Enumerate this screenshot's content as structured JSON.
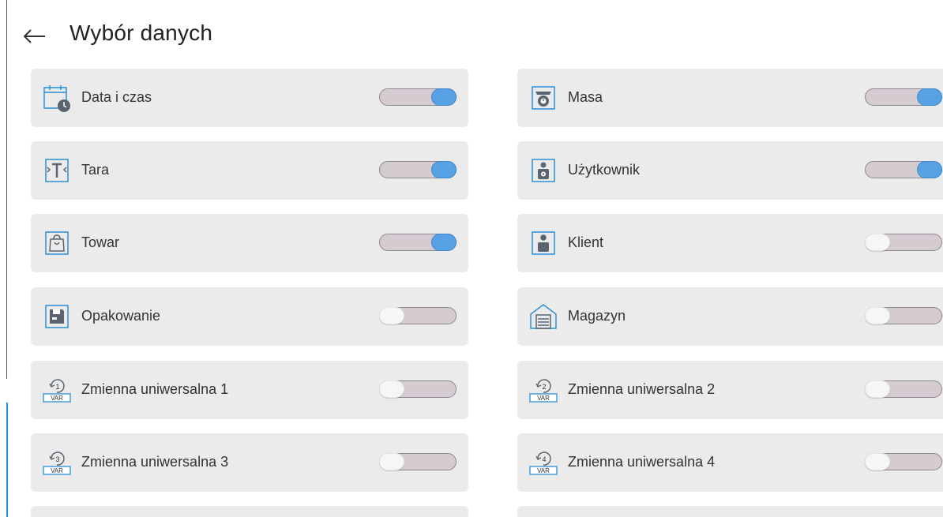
{
  "header": {
    "back_icon": "arrow-left-icon",
    "title": "Wybór danych"
  },
  "colors": {
    "toggle_on": "#56a2e5",
    "toggle_track": "#d5ccd2",
    "card": "#ebebeb",
    "icon_blue": "#2b8fd6"
  },
  "items": [
    {
      "label": "Data i czas",
      "icon": "calendar-clock-icon",
      "enabled": true
    },
    {
      "label": "Masa",
      "icon": "scale-icon",
      "enabled": true
    },
    {
      "label": "Tara",
      "icon": "tare-icon",
      "enabled": true
    },
    {
      "label": "Użytkownik",
      "icon": "user-gear-icon",
      "enabled": true
    },
    {
      "label": "Towar",
      "icon": "product-bag-icon",
      "enabled": true
    },
    {
      "label": "Klient",
      "icon": "client-icon",
      "enabled": false
    },
    {
      "label": "Opakowanie",
      "icon": "packaging-icon",
      "enabled": false
    },
    {
      "label": "Magazyn",
      "icon": "warehouse-icon",
      "enabled": false
    },
    {
      "label": "Zmienna uniwersalna 1",
      "icon": "var-1-icon",
      "var_number": "1",
      "var_tag": "VAR",
      "enabled": false
    },
    {
      "label": "Zmienna uniwersalna 2",
      "icon": "var-2-icon",
      "var_number": "2",
      "var_tag": "VAR",
      "enabled": false
    },
    {
      "label": "Zmienna uniwersalna 3",
      "icon": "var-3-icon",
      "var_number": "3",
      "var_tag": "VAR",
      "enabled": false
    },
    {
      "label": "Zmienna uniwersalna 4",
      "icon": "var-4-icon",
      "var_number": "4",
      "var_tag": "VAR",
      "enabled": false
    }
  ]
}
